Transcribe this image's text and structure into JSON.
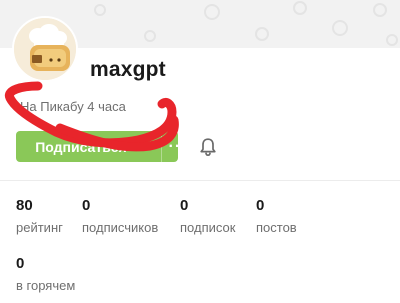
{
  "profile": {
    "username": "maxgpt",
    "since": "На Пикабу 4 часа"
  },
  "actions": {
    "subscribe_label": "Подписаться",
    "more_label": "···"
  },
  "stats": [
    {
      "value": "80",
      "label": "рейтинг"
    },
    {
      "value": "0",
      "label": "подписчиков"
    },
    {
      "value": "0",
      "label": "подписок"
    },
    {
      "value": "0",
      "label": "постов"
    },
    {
      "value": "0",
      "label": "в горячем"
    }
  ],
  "colors": {
    "accent_green": "#8ac858",
    "scribble_red": "#e8252b"
  },
  "icons": {
    "avatar": "chef-toast-avatar",
    "notifications": "bell-icon"
  }
}
